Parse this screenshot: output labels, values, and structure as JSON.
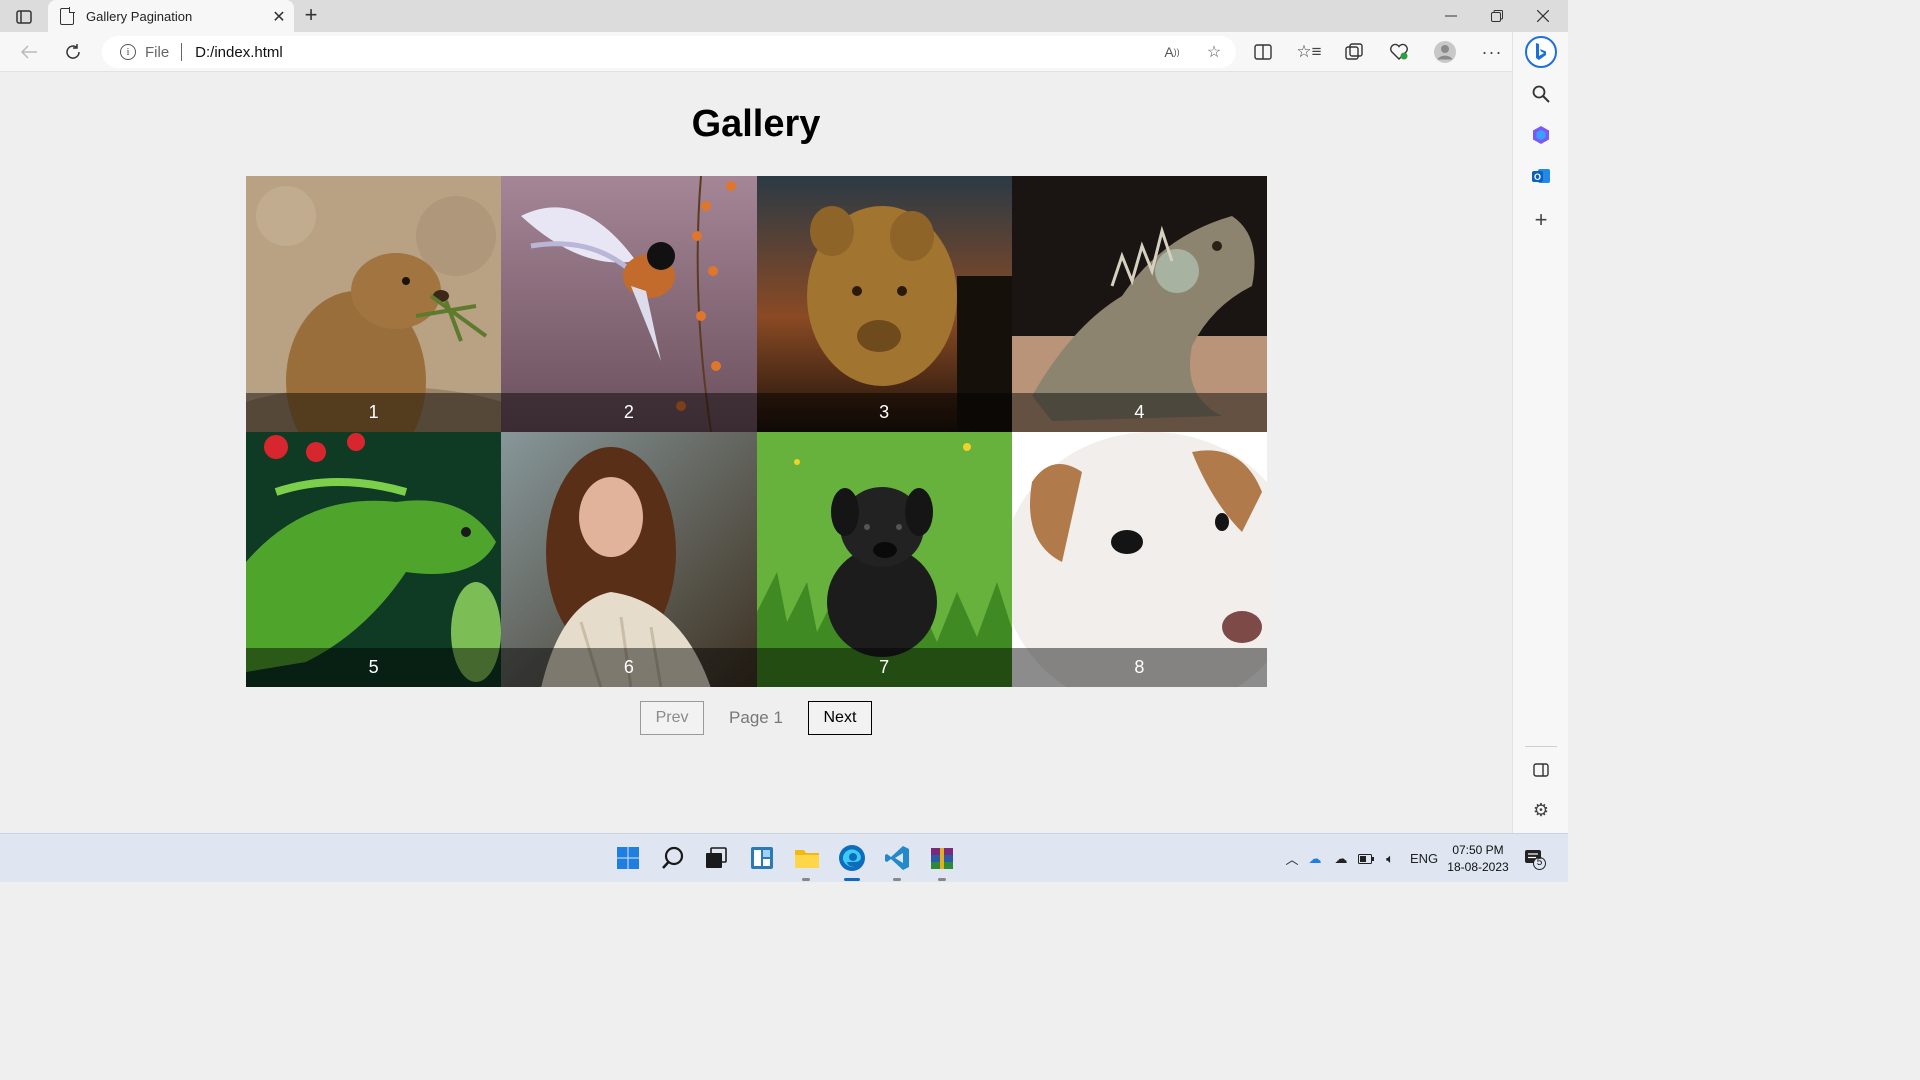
{
  "browser": {
    "tab_title": "Gallery Pagination",
    "new_tab_label": "+",
    "scheme_label": "File",
    "url": "D:/index.html"
  },
  "page": {
    "title": "Gallery",
    "tiles": [
      {
        "label": "1",
        "subject": "prairie dog"
      },
      {
        "label": "2",
        "subject": "bird in flight"
      },
      {
        "label": "3",
        "subject": "lion cub"
      },
      {
        "label": "4",
        "subject": "iguana"
      },
      {
        "label": "5",
        "subject": "green iguana"
      },
      {
        "label": "6",
        "subject": "woman in shawl"
      },
      {
        "label": "7",
        "subject": "black puppy"
      },
      {
        "label": "8",
        "subject": "white dog"
      }
    ],
    "pagination": {
      "prev_label": "Prev",
      "page_label": "Page 1",
      "next_label": "Next"
    }
  },
  "taskbar": {
    "language": "ENG",
    "time": "07:50 PM",
    "date": "18-08-2023",
    "notification_count": "5"
  },
  "colors": {
    "page_background": "#efefef",
    "edge_blue": "#0f6cbd",
    "vscode_blue": "#2489ca"
  }
}
